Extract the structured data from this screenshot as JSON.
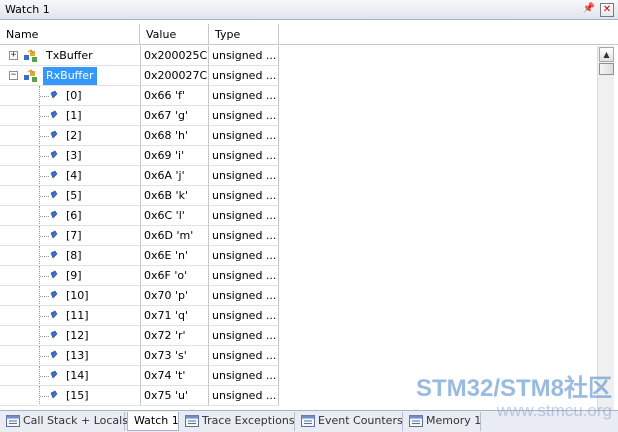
{
  "window": {
    "title": "Watch 1"
  },
  "columns": {
    "name": "Name",
    "value": "Value",
    "type": "Type"
  },
  "rows": [
    {
      "name": "TxBuffer",
      "value": "0x200025C...",
      "type": "unsigned ...",
      "kind": "struct",
      "expander": "+",
      "selected": false
    },
    {
      "name": "RxBuffer",
      "value": "0x200027C...",
      "type": "unsigned ...",
      "kind": "struct",
      "expander": "−",
      "selected": true
    },
    {
      "name": "[0]",
      "value": "0x66 'f'",
      "type": "unsigned ...",
      "kind": "element"
    },
    {
      "name": "[1]",
      "value": "0x67 'g'",
      "type": "unsigned ...",
      "kind": "element"
    },
    {
      "name": "[2]",
      "value": "0x68 'h'",
      "type": "unsigned ...",
      "kind": "element"
    },
    {
      "name": "[3]",
      "value": "0x69 'i'",
      "type": "unsigned ...",
      "kind": "element"
    },
    {
      "name": "[4]",
      "value": "0x6A 'j'",
      "type": "unsigned ...",
      "kind": "element"
    },
    {
      "name": "[5]",
      "value": "0x6B 'k'",
      "type": "unsigned ...",
      "kind": "element"
    },
    {
      "name": "[6]",
      "value": "0x6C 'l'",
      "type": "unsigned ...",
      "kind": "element"
    },
    {
      "name": "[7]",
      "value": "0x6D 'm'",
      "type": "unsigned ...",
      "kind": "element"
    },
    {
      "name": "[8]",
      "value": "0x6E 'n'",
      "type": "unsigned ...",
      "kind": "element"
    },
    {
      "name": "[9]",
      "value": "0x6F 'o'",
      "type": "unsigned ...",
      "kind": "element"
    },
    {
      "name": "[10]",
      "value": "0x70 'p'",
      "type": "unsigned ...",
      "kind": "element"
    },
    {
      "name": "[11]",
      "value": "0x71 'q'",
      "type": "unsigned ...",
      "kind": "element"
    },
    {
      "name": "[12]",
      "value": "0x72 'r'",
      "type": "unsigned ...",
      "kind": "element"
    },
    {
      "name": "[13]",
      "value": "0x73 's'",
      "type": "unsigned ...",
      "kind": "element"
    },
    {
      "name": "[14]",
      "value": "0x74 't'",
      "type": "unsigned ...",
      "kind": "element"
    },
    {
      "name": "[15]",
      "value": "0x75 'u'",
      "type": "unsigned ...",
      "kind": "element"
    }
  ],
  "tabs": [
    {
      "label": "Call Stack + Locals",
      "icon": "call-stack-icon",
      "active": false
    },
    {
      "label": "Watch 1",
      "icon": "",
      "active": true
    },
    {
      "label": "Trace Exceptions",
      "icon": "trace-exceptions-icon",
      "active": false
    },
    {
      "label": "Event Counters",
      "icon": "event-counters-icon",
      "active": false
    },
    {
      "label": "Memory 1",
      "icon": "memory-icon",
      "active": false
    }
  ],
  "watermark": {
    "main": "STM32/STM8社区",
    "sub": "www.stmcu.org"
  },
  "colors": {
    "selection": "#3399ff",
    "element_icon": "#3a6fc4"
  }
}
